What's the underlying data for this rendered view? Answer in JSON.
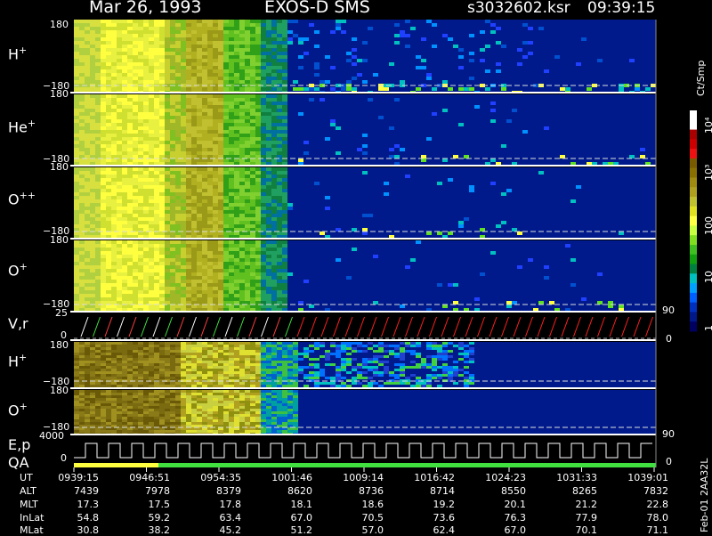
{
  "header": {
    "date": "Mar 26, 1993",
    "instrument": "EXOS-D SMS",
    "file": "s3032602.ksr",
    "time": "09:39:15"
  },
  "panels": [
    {
      "ion": "H",
      "charge": "+",
      "top": "180",
      "bottom": "−180"
    },
    {
      "ion": "He",
      "charge": "+",
      "top": "180",
      "bottom": "−180"
    },
    {
      "ion": "O",
      "charge": "++",
      "top": "180",
      "bottom": "−180"
    },
    {
      "ion": "O",
      "charge": "+",
      "top": "180",
      "bottom": "−180"
    },
    {
      "ion": "V,r",
      "charge": "",
      "top": "25",
      "bottom": "0"
    },
    {
      "ion": "H",
      "charge": "+",
      "top": "180",
      "bottom": "−180"
    },
    {
      "ion": "O",
      "charge": "+",
      "top": "180",
      "bottom": "−180"
    },
    {
      "ion": "E,p",
      "charge": "",
      "top": "4000",
      "bottom": "0"
    }
  ],
  "qa_label": "QA",
  "right_scale": {
    "upper": "90",
    "lower": "0",
    "upper2": "90",
    "lower2": "0"
  },
  "colorbar": {
    "unit": "Ct/Smp",
    "ticks": [
      "10⁴",
      "10³",
      "100",
      "10",
      "1"
    ],
    "colors": [
      "#ffffff",
      "#ffffff",
      "#aa0000",
      "#cc0000",
      "#ee1111",
      "#7a5a00",
      "#8a7000",
      "#a08a10",
      "#b0a020",
      "#c0c030",
      "#e0e020",
      "#ffff44",
      "#c8ff40",
      "#80e020",
      "#40c020",
      "#10a010",
      "#008040",
      "#00c0c0",
      "#00a0ff",
      "#0060ff",
      "#0030c0",
      "#001888",
      "#000060"
    ]
  },
  "time_axis": {
    "labels_row": [
      "UT",
      "ALT",
      "MLT",
      "InLat",
      "MLat"
    ],
    "columns": [
      {
        "UT": "0939:15",
        "ALT": "7439",
        "MLT": "17.3",
        "InLat": "54.8",
        "MLat": "30.8"
      },
      {
        "UT": "0946:51",
        "ALT": "7978",
        "MLT": "17.5",
        "InLat": "59.2",
        "MLat": "38.2"
      },
      {
        "UT": "0954:35",
        "ALT": "8379",
        "MLT": "17.8",
        "InLat": "63.4",
        "MLat": "45.2"
      },
      {
        "UT": "1001:46",
        "ALT": "8620",
        "MLT": "18.1",
        "InLat": "67.0",
        "MLat": "51.2"
      },
      {
        "UT": "1009:14",
        "ALT": "8736",
        "MLT": "18.6",
        "InLat": "70.5",
        "MLat": "57.0"
      },
      {
        "UT": "1016:42",
        "ALT": "8714",
        "MLT": "19.2",
        "InLat": "73.6",
        "MLat": "62.4"
      },
      {
        "UT": "1024:23",
        "ALT": "8550",
        "MLT": "20.1",
        "InLat": "76.3",
        "MLat": "67.0"
      },
      {
        "UT": "1031:33",
        "ALT": "8265",
        "MLT": "21.2",
        "InLat": "77.9",
        "MLat": "70.1"
      },
      {
        "UT": "1039:01",
        "ALT": "7832",
        "MLT": "22.8",
        "InLat": "78.0",
        "MLat": "71.1"
      }
    ]
  },
  "footer_id": "Feb-01 2AA32L",
  "chart_data": {
    "type": "heatmap",
    "title": "Mar 26, 1993 EXOS-D SMS",
    "x": [
      "0939:15",
      "0946:51",
      "0954:35",
      "1001:46",
      "1009:14",
      "1016:42",
      "1024:23",
      "1031:33",
      "1039:01"
    ],
    "ylim": [
      -180,
      180
    ],
    "series": [
      {
        "name": "H+",
        "values": [
          3,
          3,
          2,
          2,
          1,
          1,
          1,
          0,
          0
        ]
      },
      {
        "name": "He+",
        "values": [
          3,
          3,
          2,
          2,
          0,
          0,
          0,
          0,
          0
        ]
      },
      {
        "name": "O++",
        "values": [
          3,
          3,
          2,
          2,
          0,
          0,
          0,
          0,
          0
        ]
      },
      {
        "name": "O+",
        "values": [
          3,
          3,
          2,
          2,
          0,
          0,
          0,
          0,
          0
        ]
      }
    ]
  }
}
